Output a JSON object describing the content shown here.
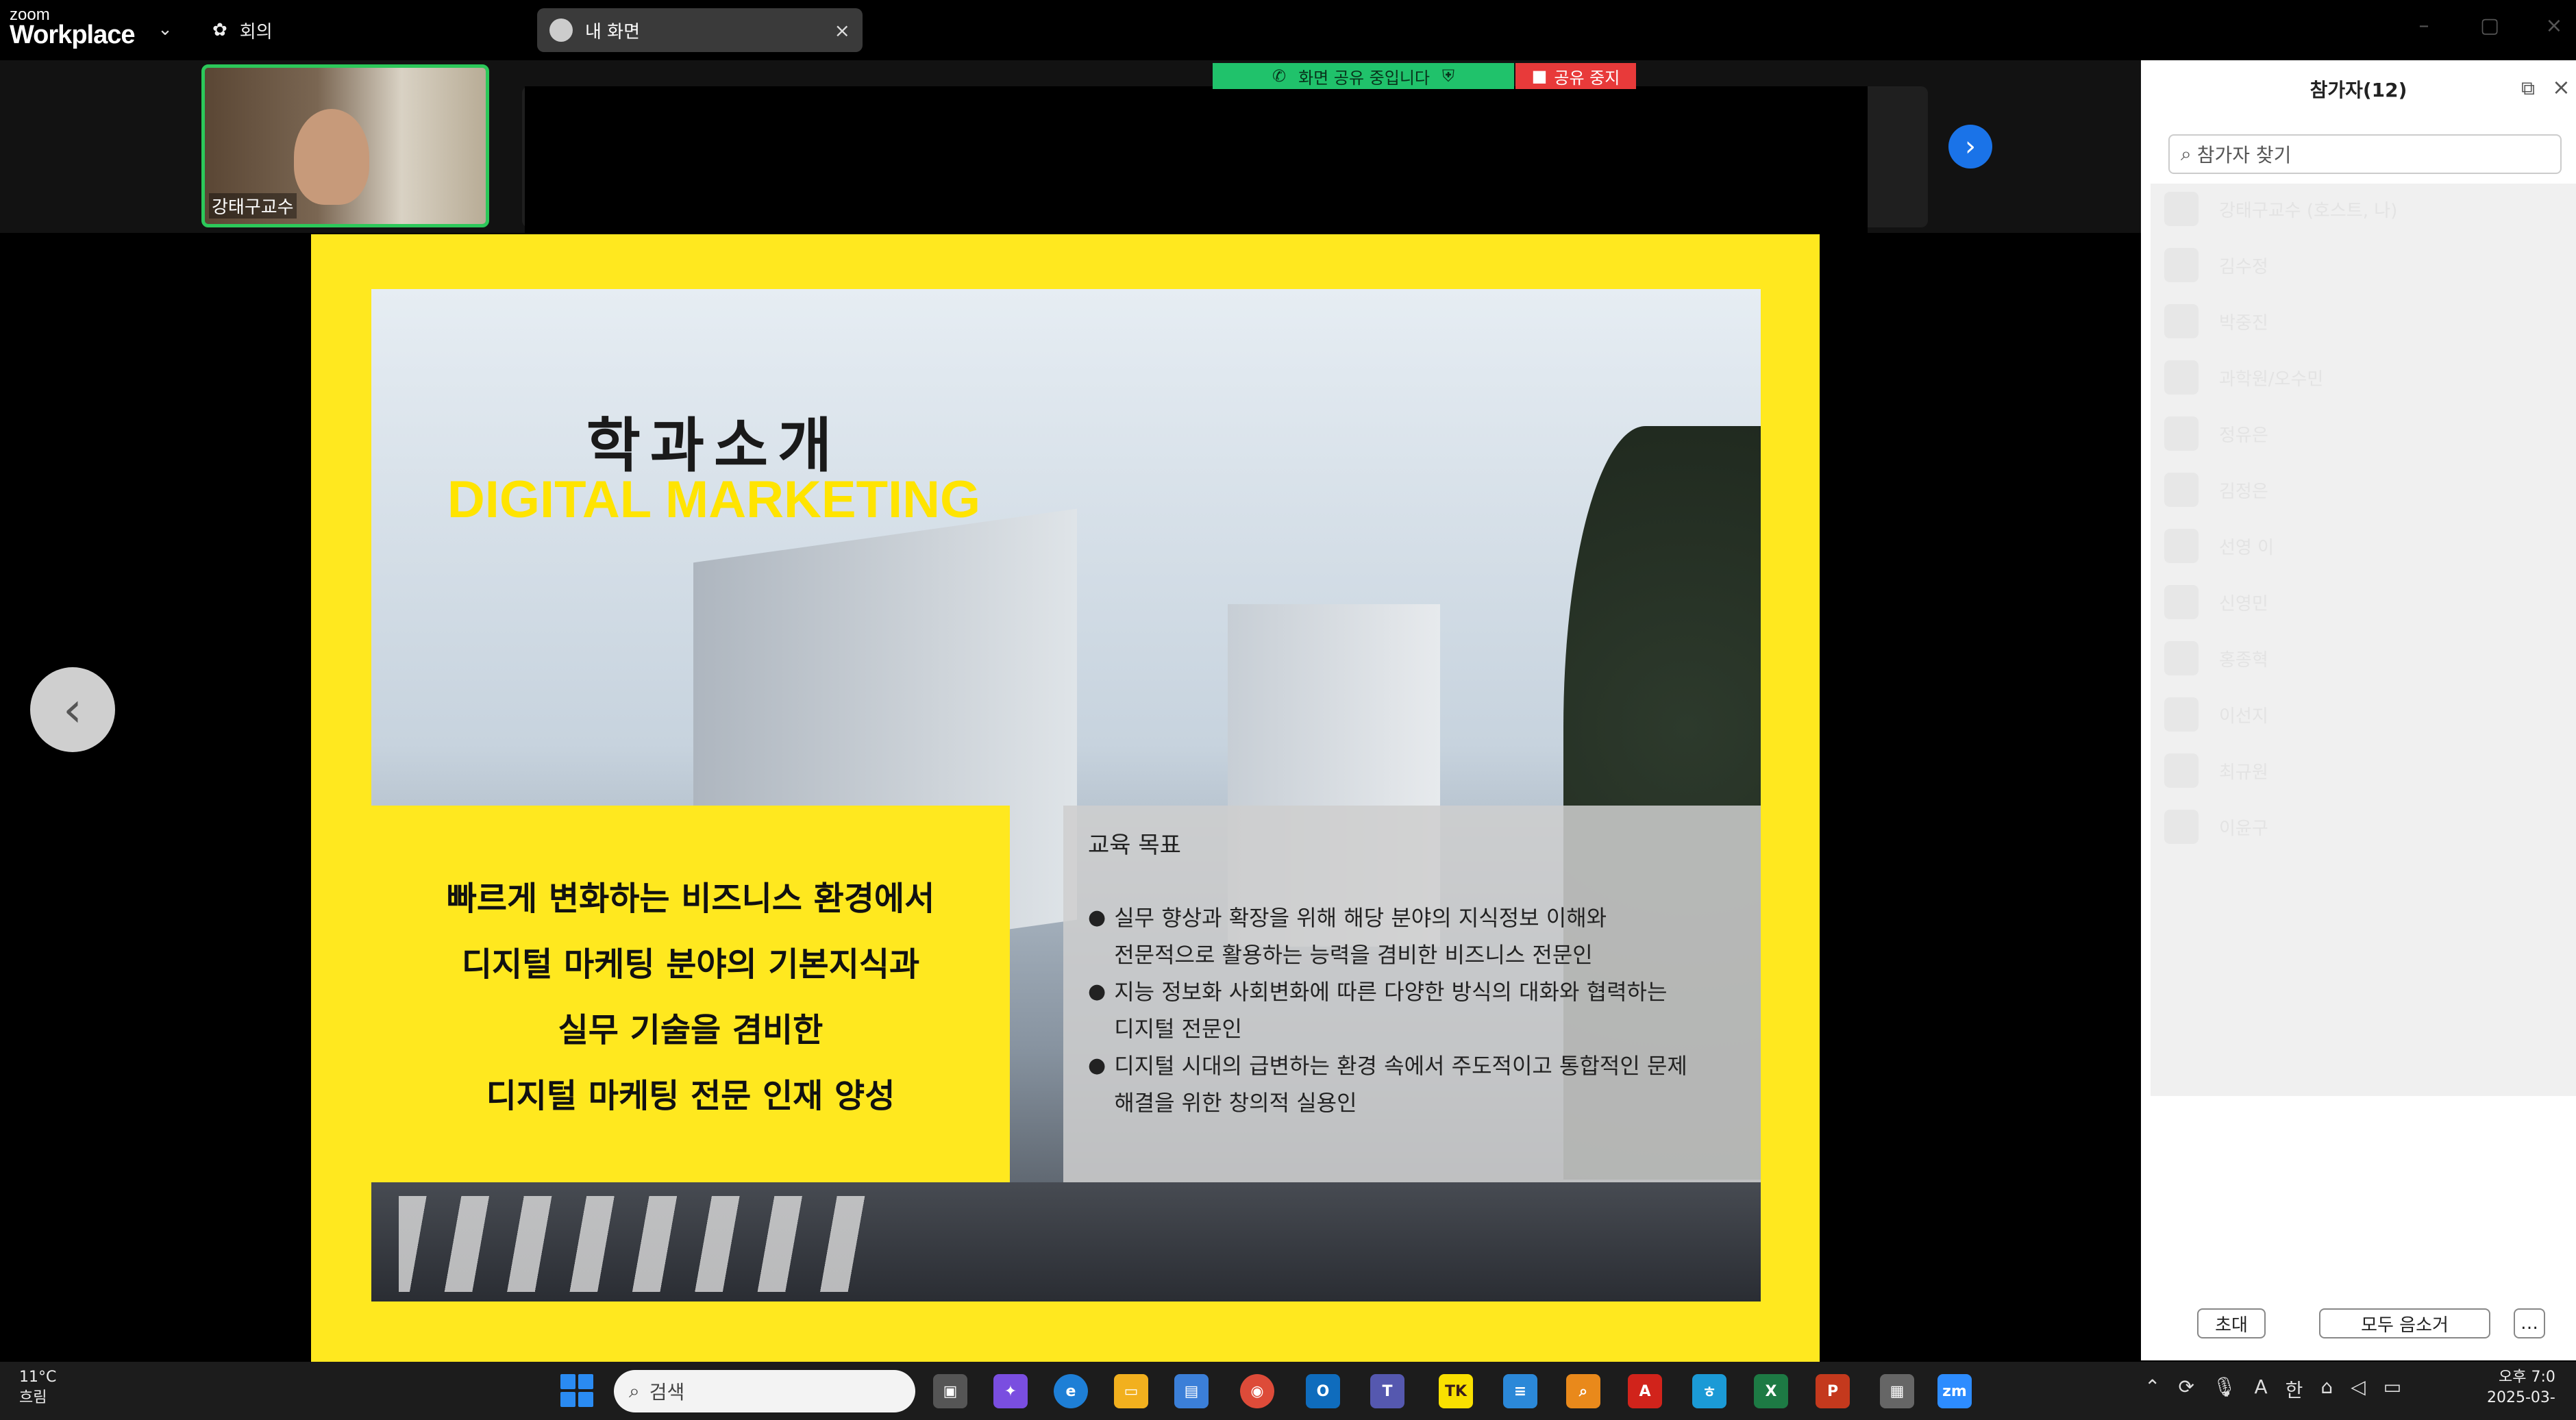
{
  "app": {
    "brand_small": "zoom",
    "brand_name": "Workplace",
    "meeting_menu_label": "회의",
    "tab_label": "내 화면"
  },
  "share_bar": {
    "sharing_text": "화면 공유 중입니다",
    "stop_label": "공유 중지"
  },
  "video": {
    "participant_name": "강태구교수"
  },
  "slide": {
    "title_ko": "학과소개",
    "title_en": "DIGITAL MARKETING",
    "mission_lines": [
      "빠르게 변화하는 비즈니스 환경에서",
      "디지털 마케팅 분야의 기본지식과",
      "실무 기술을 겸비한",
      "디지털 마케팅 전문 인재 양성"
    ],
    "goals_title": "교육 목표",
    "goals": [
      [
        "실무 향상과 확장을 위해 해당 분야의 지식정보 이해와",
        "전문적으로 활용하는 능력을 겸비한 비즈니스 전문인"
      ],
      [
        "지능 정보화 사회변화에 따른 다양한 방식의 대화와 협력하는",
        "디지털 전문인"
      ],
      [
        "디지털 시대의 급변하는 환경 속에서 주도적이고 통합적인 문제",
        "해결을 위한 창의적 실용인"
      ]
    ]
  },
  "participants_panel": {
    "title": "참가자(12)",
    "search_placeholder": "참가자 찾기",
    "names": [
      "강태구교수 (호스트, 나)",
      "김수정",
      "박중진",
      "과학원/오수민",
      "정유은",
      "김정은",
      "선영 이",
      "신영민",
      "홍종혁",
      "이선지",
      "최규원",
      "이윤구"
    ],
    "invite_label": "초대",
    "mute_all_label": "모두 음소거",
    "more_label": "…"
  },
  "taskbar": {
    "temperature": "11°C",
    "weather": "흐림",
    "search_placeholder": "검색",
    "time": "오후 7:0",
    "date": "2025-03-"
  }
}
